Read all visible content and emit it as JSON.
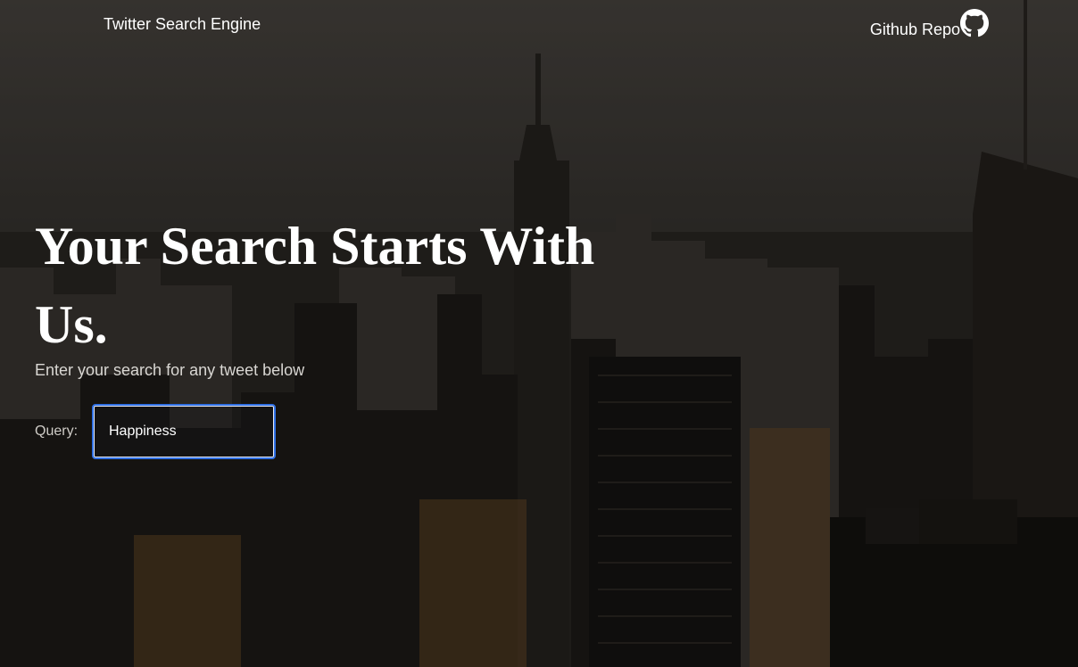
{
  "header": {
    "brand": "Twitter Search Engine",
    "repo_label": "Github Repo",
    "repo_icon": "github-icon"
  },
  "hero": {
    "title": "Your Search Starts With Us.",
    "subtitle": "Enter your search for any tweet below"
  },
  "search": {
    "label": "Query:",
    "value": "Happiness",
    "placeholder": ""
  },
  "colors": {
    "focus_border": "#2f6fe4",
    "text": "#ffffff"
  }
}
